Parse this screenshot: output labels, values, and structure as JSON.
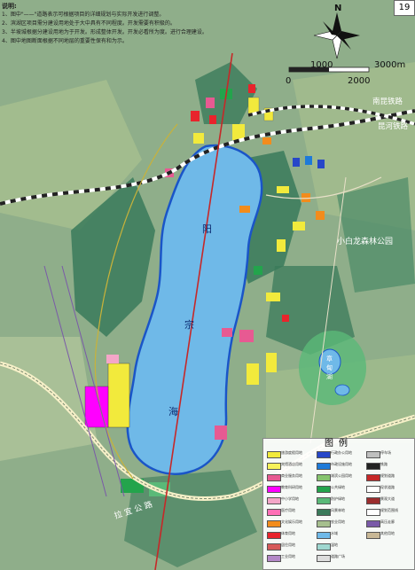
{
  "header": {
    "notes_title": "说明:",
    "notes": [
      "1、图中\"——\"道路表示可根据项目的详细规划与实际开发进行调整。",
      "2、滨湖区项目需分建设用地处于大中具有不同程度。开发需要有积极的。",
      "3、半坡城根据分建设用地为于开发。形成整体开发。开发必看所为度。进行合理建设。",
      "4、图中地图断面根据不同地层的重要性保有和为示。"
    ],
    "sheet_tag": "19"
  },
  "compass": {
    "north_label": "N"
  },
  "scale_bar": {
    "labels": [
      "0",
      "1000",
      "2000",
      "3000m"
    ]
  },
  "map_labels": {
    "lake_chars": [
      "阳",
      "宗",
      "海"
    ],
    "park": "小白龙森林公园",
    "railway_1": "南昆铁路",
    "railway_2": "昆河铁路",
    "zhanghe": "章",
    "zhanghe2": "甸",
    "zhanghe3": "湖",
    "road_bottom": "拉 宜 公 路"
  },
  "colors": {
    "lake": "#6fb9e8",
    "lake_edge": "#1a55c8",
    "forest": "#3a7a5a",
    "farmland": "#a6bf8e",
    "resort_yellow": "#f2ea3c",
    "hotel_pink": "#e75a92",
    "magenta": "#ff00ff",
    "red": "#e8242c",
    "orange": "#f28c1c",
    "green": "#23a44c",
    "road_red": "#c62828",
    "railway": "#222222"
  },
  "legend": {
    "title": "图例",
    "items": [
      {
        "label": "旅游度假用地",
        "color": "#f2ea3c"
      },
      {
        "label": "宾馆酒店用地",
        "color": "#f7f25a"
      },
      {
        "label": "商业服务用地",
        "color": "#e75a92"
      },
      {
        "label": "教育科研用地",
        "color": "#ff00ff"
      },
      {
        "label": "中小学用地",
        "color": "#f4a6c8"
      },
      {
        "label": "医疗用地",
        "color": "#ff6fb6"
      },
      {
        "label": "文化娱乐用地",
        "color": "#f28c1c"
      },
      {
        "label": "体育用地",
        "color": "#e8242c"
      },
      {
        "label": "居住用地",
        "color": "#d65a5a"
      },
      {
        "label": "工业用地",
        "color": "#b388c8"
      },
      {
        "label": "行政办公用地",
        "color": "#2747c8"
      },
      {
        "label": "市政设施用地",
        "color": "#1e7ad8"
      },
      {
        "label": "湖滨公园用地",
        "color": "#86c46e"
      },
      {
        "label": "公共绿地",
        "color": "#23a44c"
      },
      {
        "label": "防护绿地",
        "color": "#5ab978"
      },
      {
        "label": "风景林地",
        "color": "#3a7a5a"
      },
      {
        "label": "农业用地",
        "color": "#a6bf8e"
      },
      {
        "label": "水域",
        "color": "#6fb9e8"
      },
      {
        "label": "湿地",
        "color": "#9ed7d0"
      },
      {
        "label": "道路广场",
        "color": "#dddddd"
      },
      {
        "label": "停车场",
        "color": "#bfbfbf"
      },
      {
        "label": "铁路",
        "color": "#222222"
      },
      {
        "label": "规划道路",
        "color": "#c62828"
      },
      {
        "label": "现状道路",
        "color": "#ffffff"
      },
      {
        "label": "景观大道",
        "color": "#9b2d2d"
      },
      {
        "label": "规划范围线",
        "color": "#ffffff"
      },
      {
        "label": "高压走廊",
        "color": "#7a5aa8"
      },
      {
        "label": "其他用地",
        "color": "#c8b896"
      }
    ]
  }
}
